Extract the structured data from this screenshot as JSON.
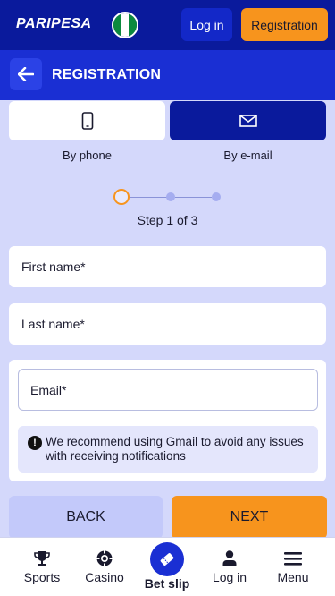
{
  "header": {
    "logo_text": "PARIPESA",
    "flag_colors": [
      "#0b8a3e",
      "#ffffff",
      "#0b8a3e"
    ],
    "login_label": "Log in",
    "registration_label": "Registration"
  },
  "subheader": {
    "title": "REGISTRATION",
    "back_icon": "arrow-left-icon"
  },
  "methods": [
    {
      "label": "By phone",
      "icon": "phone-icon",
      "selected": false
    },
    {
      "label": "By e-mail",
      "icon": "envelope-icon",
      "selected": true
    }
  ],
  "stepper": {
    "current": 1,
    "total": 3,
    "text": "Step 1 of 3"
  },
  "form": {
    "first_name_placeholder": "First name*",
    "last_name_placeholder": "Last name*",
    "email_placeholder": "Email*",
    "notice_text": "We recommend using Gmail to avoid any issues with receiving notifications"
  },
  "actions": {
    "back_label": "BACK",
    "next_label": "NEXT"
  },
  "bottom_nav": {
    "sports": "Sports",
    "casino": "Casino",
    "betslip": "Bet slip",
    "login": "Log in",
    "menu": "Menu"
  },
  "colors": {
    "brand_dark": "#0a1a9c",
    "brand": "#1a2fd3",
    "accent": "#f7941d",
    "background": "#d4d8fb"
  }
}
